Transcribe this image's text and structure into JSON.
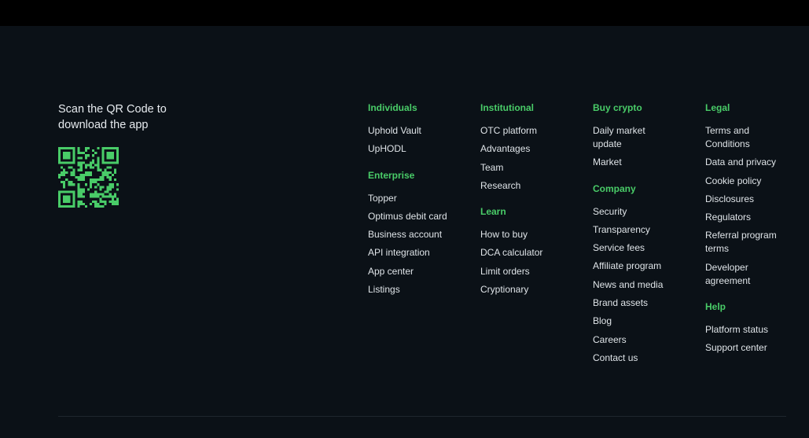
{
  "qr": {
    "caption": "Scan the QR Code to download the app",
    "accent": "#49cc68"
  },
  "columns": [
    {
      "sections": [
        {
          "heading": "Individuals",
          "links": [
            "Uphold Vault",
            "UpHODL"
          ]
        },
        {
          "heading": "Enterprise",
          "links": [
            "Topper",
            "Optimus debit card",
            "Business account",
            "API integration",
            "App center",
            "Listings"
          ]
        }
      ]
    },
    {
      "sections": [
        {
          "heading": "Institutional",
          "links": [
            "OTC platform",
            "Advantages",
            "Team",
            "Research"
          ]
        },
        {
          "heading": "Learn",
          "links": [
            "How to buy",
            "DCA calculator",
            "Limit orders",
            "Cryptionary"
          ]
        }
      ]
    },
    {
      "sections": [
        {
          "heading": "Buy crypto",
          "links": [
            "Daily market update",
            "Market"
          ]
        },
        {
          "heading": "Company",
          "links": [
            "Security",
            "Transparency",
            "Service fees",
            "Affiliate program",
            "News and media",
            "Brand assets",
            "Blog",
            "Careers",
            "Contact us"
          ]
        }
      ]
    },
    {
      "sections": [
        {
          "heading": "Legal",
          "links": [
            "Terms and Conditions",
            "Data and privacy",
            "Cookie policy",
            "Disclosures",
            "Regulators",
            "Referral program terms",
            "Developer agreement"
          ]
        },
        {
          "heading": "Help",
          "links": [
            "Platform status",
            "Support center"
          ]
        }
      ]
    }
  ],
  "colors": {
    "background": "#0b1117",
    "heading": "#49cc68",
    "link": "#dfe4e8"
  }
}
